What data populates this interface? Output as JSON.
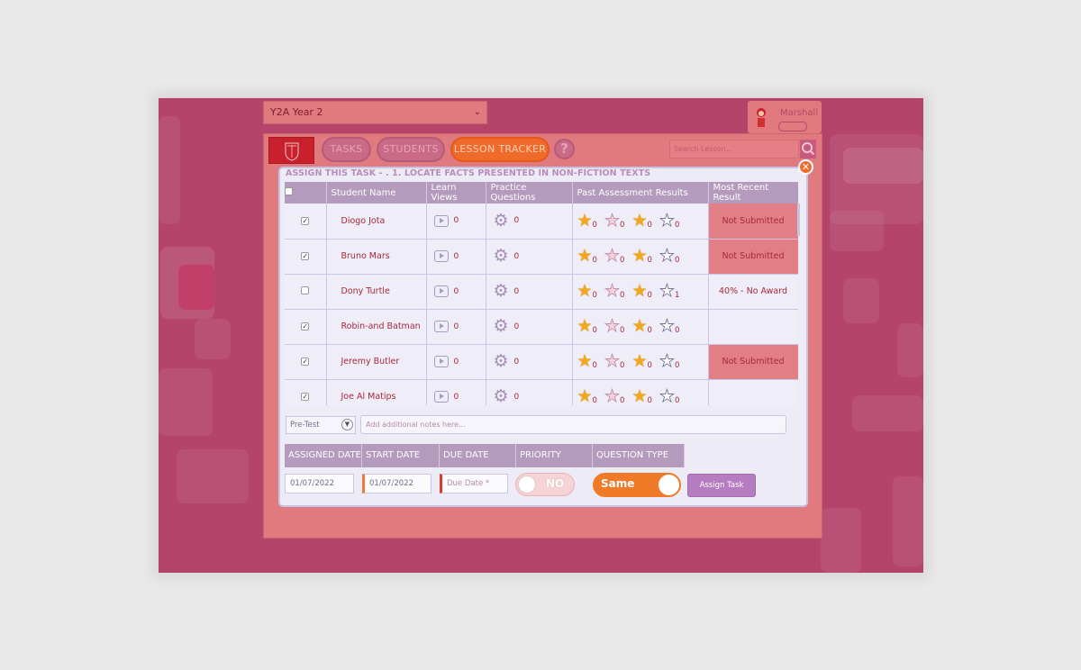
{
  "header": {
    "class_select": "Y2A Year 2",
    "user_name": "Marshall"
  },
  "nav": {
    "tasks": "TASKS",
    "students": "STUDENTS",
    "lesson_tracker": "LESSON TRACKER",
    "help": "?",
    "search_placeholder": "Search Lesson..."
  },
  "modal": {
    "title": "ASSIGN THIS TASK - . 1. LOCATE FACTS PRESENTED IN NON-FICTION TEXTS",
    "columns": [
      "Student Name",
      "Learn Views",
      "Practice Questions",
      "Past Assessment Results",
      "Most Recent Result"
    ],
    "rows": [
      {
        "checked": true,
        "name": "Diogo  Jota",
        "views": "0",
        "practice": "0",
        "s1": "0",
        "s2": "0",
        "s3": "0",
        "s4": "0",
        "result": "Not Submitted"
      },
      {
        "checked": true,
        "name": "Bruno Mars",
        "views": "0",
        "practice": "0",
        "s1": "0",
        "s2": "0",
        "s3": "0",
        "s4": "0",
        "result": "Not Submitted"
      },
      {
        "checked": false,
        "name": "Dony Turtle",
        "views": "0",
        "practice": "0",
        "s1": "0",
        "s2": "0",
        "s3": "0",
        "s4": "1",
        "result": "40% - No Award"
      },
      {
        "checked": true,
        "name": "Robin-and Batman",
        "views": "0",
        "practice": "0",
        "s1": "0",
        "s2": "0",
        "s3": "0",
        "s4": "0",
        "result": ""
      },
      {
        "checked": true,
        "name": "Jeremy Butler",
        "views": "0",
        "practice": "0",
        "s1": "0",
        "s2": "0",
        "s3": "0",
        "s4": "0",
        "result": "Not Submitted"
      },
      {
        "checked": true,
        "name": "Joe Al Matips",
        "views": "0",
        "practice": "0",
        "s1": "0",
        "s2": "0",
        "s3": "0",
        "s4": "0",
        "result": ""
      }
    ],
    "test_type": "Pre-Test",
    "notes_placeholder": "Add additional notes here...",
    "labels": {
      "assigned_date": "ASSIGNED DATE",
      "start_date": "START DATE",
      "due_date": "DUE DATE",
      "priority": "PRIORITY",
      "question_type": "QUESTION TYPE"
    },
    "assigned_date": "01/07/2022",
    "start_date": "01/07/2022",
    "due_date_placeholder": "Due Date *",
    "priority": "NO",
    "question_type": "Same",
    "assign_button": "Assign Task"
  },
  "colors": {
    "background": "#b4446a",
    "accent_orange": "#f06a2a",
    "table_header": "#b49abc",
    "not_submitted": "#e27e86"
  }
}
